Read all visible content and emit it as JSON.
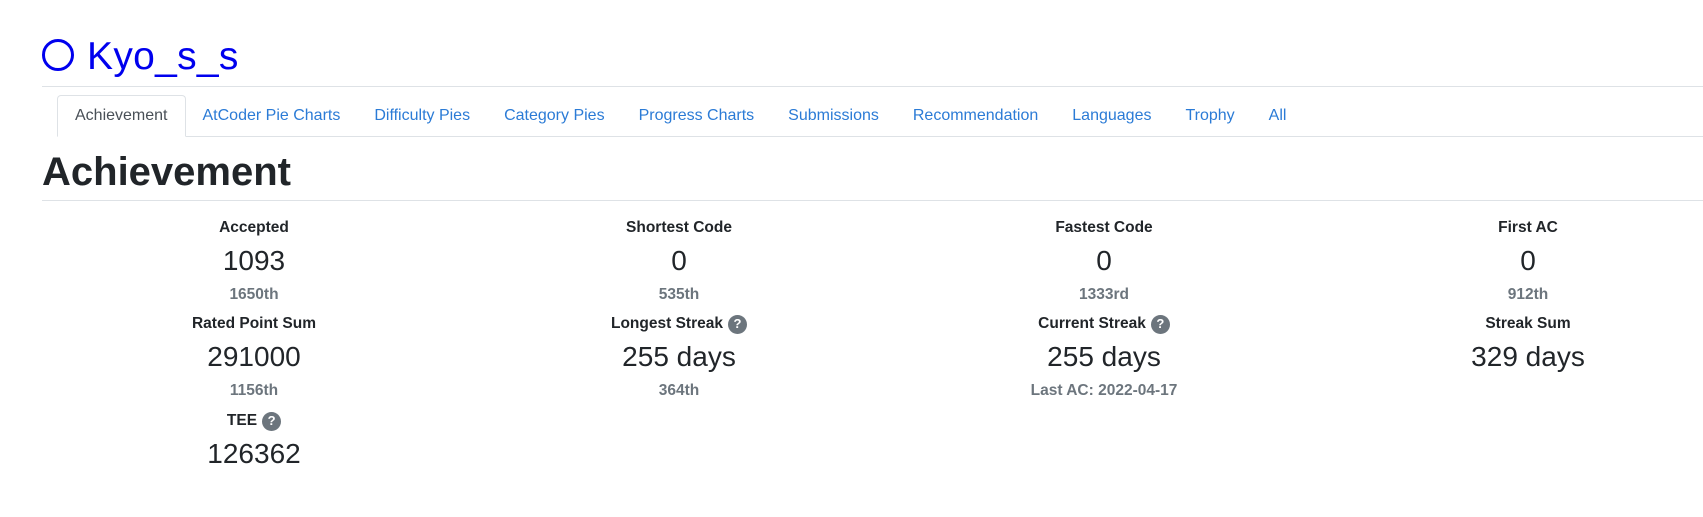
{
  "user": {
    "name": "Kyo_s_s"
  },
  "tabs": [
    {
      "label": "Achievement",
      "active": true
    },
    {
      "label": "AtCoder Pie Charts"
    },
    {
      "label": "Difficulty Pies"
    },
    {
      "label": "Category Pies"
    },
    {
      "label": "Progress Charts"
    },
    {
      "label": "Submissions"
    },
    {
      "label": "Recommendation"
    },
    {
      "label": "Languages"
    },
    {
      "label": "Trophy"
    },
    {
      "label": "All"
    }
  ],
  "section": {
    "title": "Achievement"
  },
  "stats": {
    "accepted": {
      "label": "Accepted",
      "value": "1093",
      "rank": "1650th"
    },
    "shortest_code": {
      "label": "Shortest Code",
      "value": "0",
      "rank": "535th"
    },
    "fastest_code": {
      "label": "Fastest Code",
      "value": "0",
      "rank": "1333rd"
    },
    "first_ac": {
      "label": "First AC",
      "value": "0",
      "rank": "912th"
    },
    "rated_point_sum": {
      "label": "Rated Point Sum",
      "value": "291000",
      "rank": "1156th"
    },
    "longest_streak": {
      "label": "Longest Streak",
      "value": "255 days",
      "rank": "364th"
    },
    "current_streak": {
      "label": "Current Streak",
      "value": "255 days",
      "last_ac": "Last AC: 2022-04-17"
    },
    "streak_sum": {
      "label": "Streak Sum",
      "value": "329 days"
    },
    "tee": {
      "label": "TEE",
      "value": "126362"
    }
  },
  "help_icon_glyph": "?",
  "colors": {
    "user_link": "#0000ee",
    "tab_link": "#2b7bd6",
    "muted": "#6c757d",
    "help_badge": "#6c757d"
  }
}
